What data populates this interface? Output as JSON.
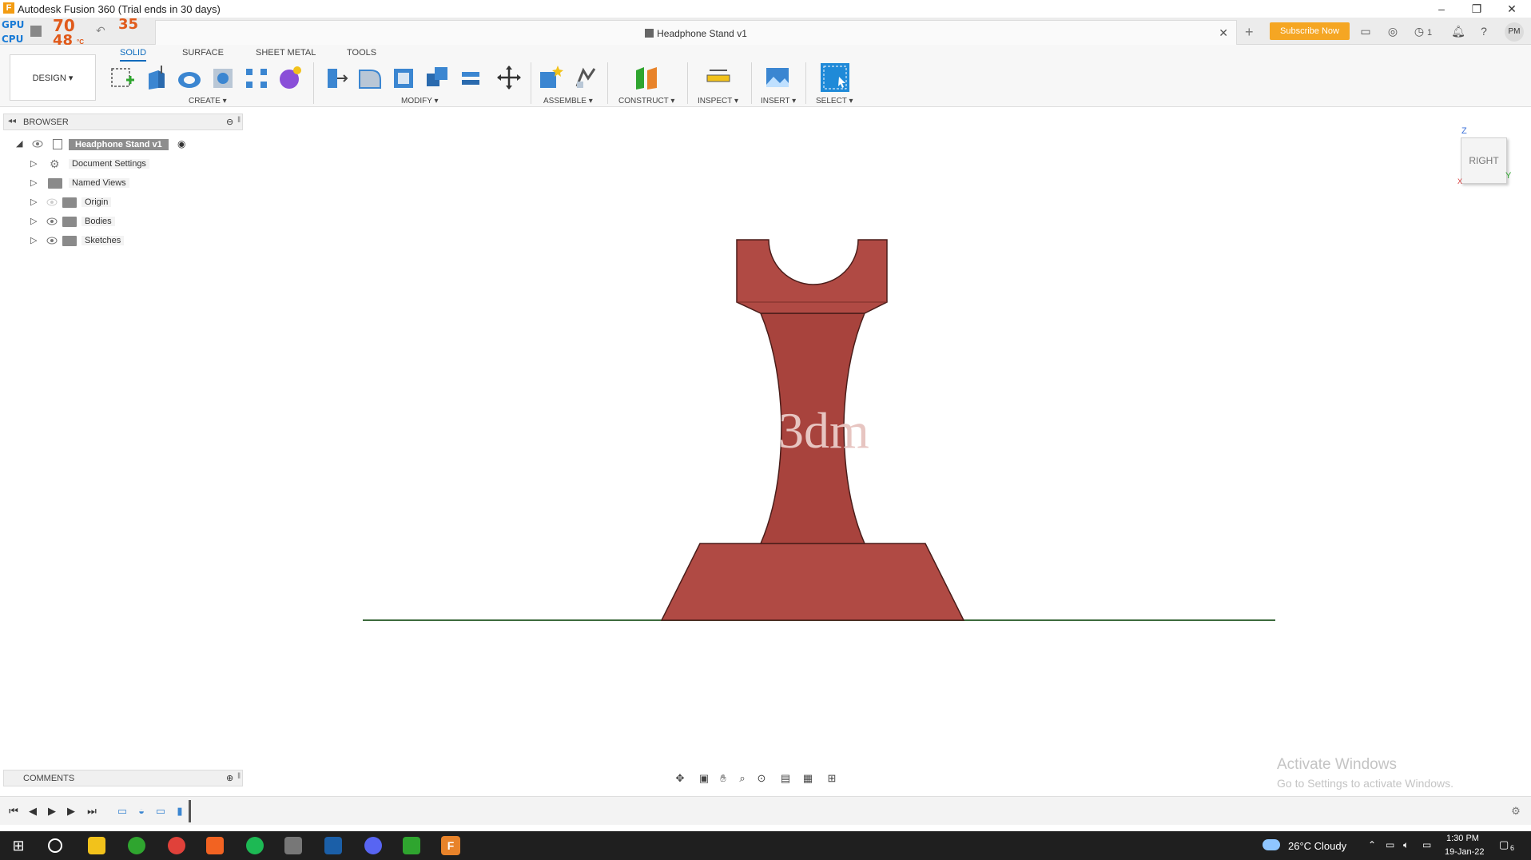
{
  "window": {
    "title": "Autodesk Fusion 360 (Trial ends in 30 days)"
  },
  "gpu_overlay": {
    "gpu_label": "GPU",
    "cpu_label": "CPU",
    "gpu_temp": "70",
    "cpu_temp": "48",
    "extra_temp": "35",
    "unit": "°C"
  },
  "document_tab": {
    "title": "Headphone Stand v1"
  },
  "header": {
    "subscribe_label": "Subscribe Now",
    "jobs_count": "1",
    "avatar_initials": "PM"
  },
  "toolbar": {
    "workspace_label": "DESIGN ▾",
    "tabs": [
      "SOLID",
      "SURFACE",
      "SHEET METAL",
      "TOOLS"
    ],
    "groups": {
      "create": "CREATE ▾",
      "modify": "MODIFY ▾",
      "assemble": "ASSEMBLE ▾",
      "construct": "CONSTRUCT ▾",
      "inspect": "INSPECT ▾",
      "insert": "INSERT ▾",
      "select": "SELECT ▾"
    }
  },
  "browser": {
    "header": "BROWSER",
    "root": "Headphone Stand v1",
    "items": [
      "Document Settings",
      "Named Views",
      "Origin",
      "Bodies",
      "Sketches"
    ]
  },
  "viewcube": {
    "face": "RIGHT",
    "z_axis": "Z",
    "y_axis": "Y",
    "x_axis": "X"
  },
  "model": {
    "engraving_text": "3dm"
  },
  "comments": {
    "label": "COMMENTS"
  },
  "watermark": {
    "line1": "Activate Windows",
    "line2": "Go to Settings to activate Windows."
  },
  "taskbar": {
    "weather": "26°C  Cloudy",
    "time": "1:30 PM",
    "date": "19-Jan-22",
    "notifications_count": "6"
  },
  "colors": {
    "accent": "#0d6bbd",
    "model": "#b04a44",
    "subscribe": "#f5a623",
    "ground": "#3d6b3d"
  }
}
